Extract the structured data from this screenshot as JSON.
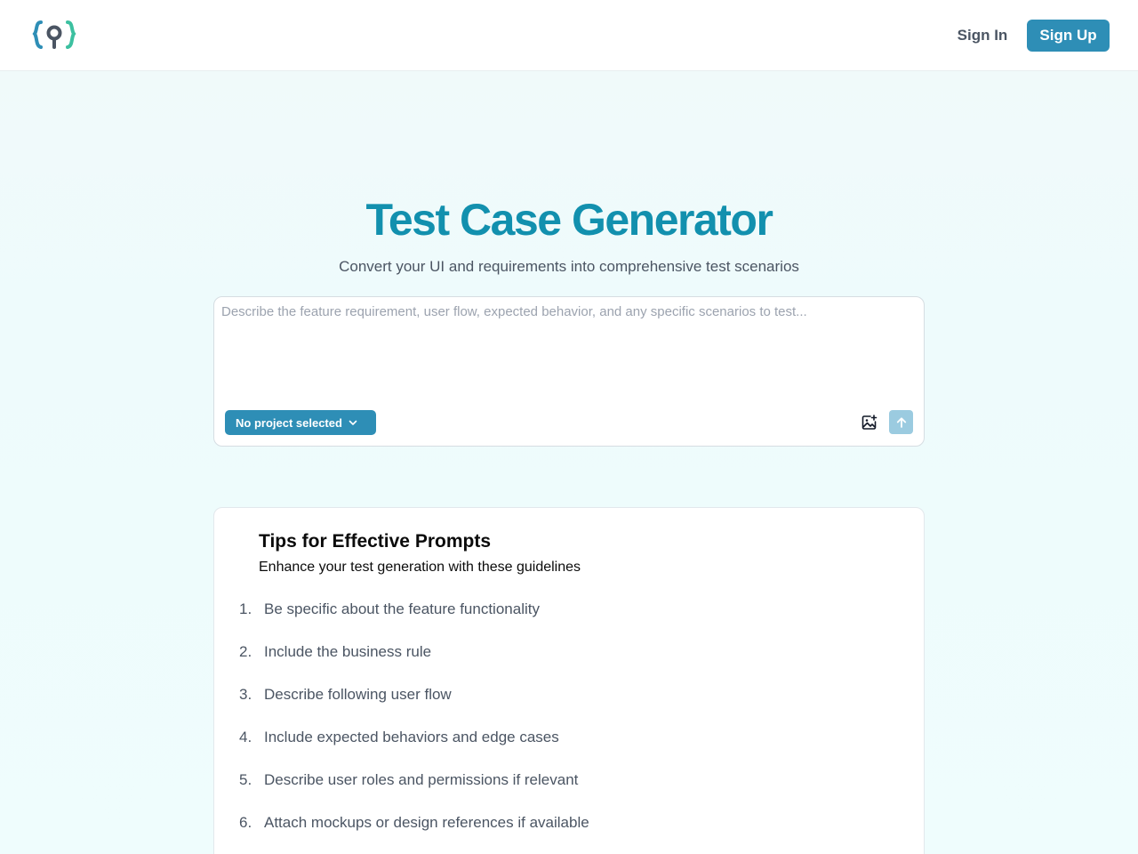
{
  "header": {
    "logo_icon": "curly-brace-pin-logo",
    "sign_in_label": "Sign In",
    "sign_up_label": "Sign Up"
  },
  "hero": {
    "title": "Test Case Generator",
    "subtitle": "Convert your UI and requirements into comprehensive test scenarios"
  },
  "prompt": {
    "placeholder": "Describe the feature requirement, user flow, expected behavior, and any specific scenarios to test...",
    "value": "",
    "project_select_label": "No project selected",
    "attach_icon": "image-plus-icon",
    "send_icon": "arrow-up-icon"
  },
  "tips": {
    "title": "Tips for Effective Prompts",
    "subtitle": "Enhance your test generation with these guidelines",
    "items": [
      {
        "num": "1.",
        "text": "Be specific about the feature functionality"
      },
      {
        "num": "2.",
        "text": "Include the business rule"
      },
      {
        "num": "3.",
        "text": "Describe following user flow"
      },
      {
        "num": "4.",
        "text": "Include expected behaviors and edge cases"
      },
      {
        "num": "5.",
        "text": "Describe user roles and permissions if relevant"
      },
      {
        "num": "6.",
        "text": "Attach mockups or design references if available"
      }
    ]
  },
  "colors": {
    "brand": "#1290ae",
    "button": "#2e8eb6",
    "logo_accent": "#3cc0a0",
    "logo_dark": "#4b5563"
  }
}
